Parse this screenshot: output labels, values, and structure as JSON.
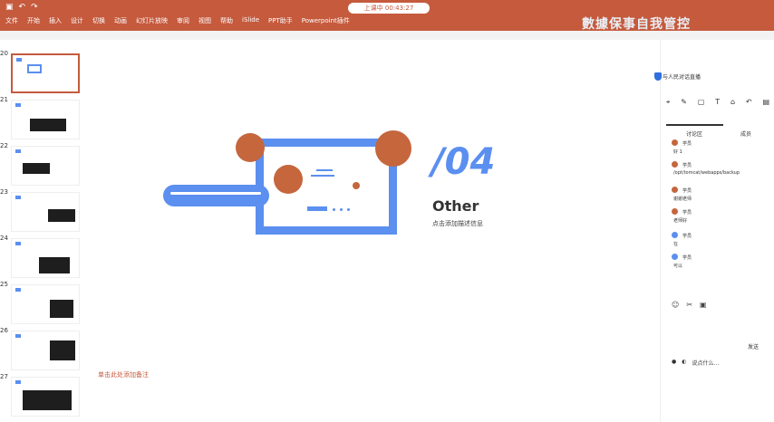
{
  "titlebar": {
    "recording": "上课中 00:43:27",
    "banner": "數據保事自我管控"
  },
  "menu": [
    "文件",
    "开始",
    "插入",
    "设计",
    "切换",
    "动画",
    "幻灯片放映",
    "审阅",
    "视图",
    "帮助",
    "iSlide",
    "PPT助手",
    "Powerpoint插件"
  ],
  "slide": {
    "number": "/04",
    "title": "Other",
    "description": "点击添加描述信息",
    "notes_placeholder": "单击此处添加备注"
  },
  "thumbnails": {
    "numbers": [
      "20",
      "21",
      "22",
      "23",
      "24",
      "25",
      "26",
      "27"
    ]
  },
  "panel": {
    "header": "与人民对话直播",
    "tab_discussion": "讨论区",
    "tab_other": "成员",
    "messages": [
      {
        "name": "学员",
        "text": "好 1"
      },
      {
        "name": "学员",
        "text": "/opt/tomcat/webapps/backup"
      },
      {
        "name": "学员",
        "text": "谢谢老师"
      },
      {
        "name": "学员",
        "text": "老师好"
      },
      {
        "name": "学员",
        "text": "在"
      },
      {
        "name": "学员",
        "text": "可以"
      }
    ],
    "send": "发送",
    "input": "说点什么..."
  },
  "colors": {
    "accent": "#c55a3d",
    "blue": "#5b8ff0",
    "circle": "#c5663d"
  }
}
